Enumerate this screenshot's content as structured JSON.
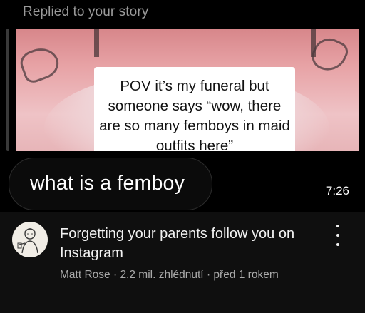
{
  "story_reply": {
    "header_label": "Replied to your story",
    "caption": "POV it’s my funeral but someone says “wow, there are so many femboys in maid outfits here”",
    "reply_message": "what is a femboy",
    "timestamp": "7:26"
  },
  "video": {
    "title": "Forgetting your parents follow you on Instagram",
    "channel": "Matt Rose",
    "views": "2,2 mil. zhlédnutí",
    "age": "před 1 rokem",
    "separator": "·"
  },
  "icons": {
    "more": "more-vertical-icon",
    "avatar": "channel-avatar"
  },
  "colors": {
    "background": "#0f0f0f",
    "caption_bg": "#ffffff",
    "meta_text": "#aaaaaa",
    "story_tint": "#e7a2a5"
  }
}
